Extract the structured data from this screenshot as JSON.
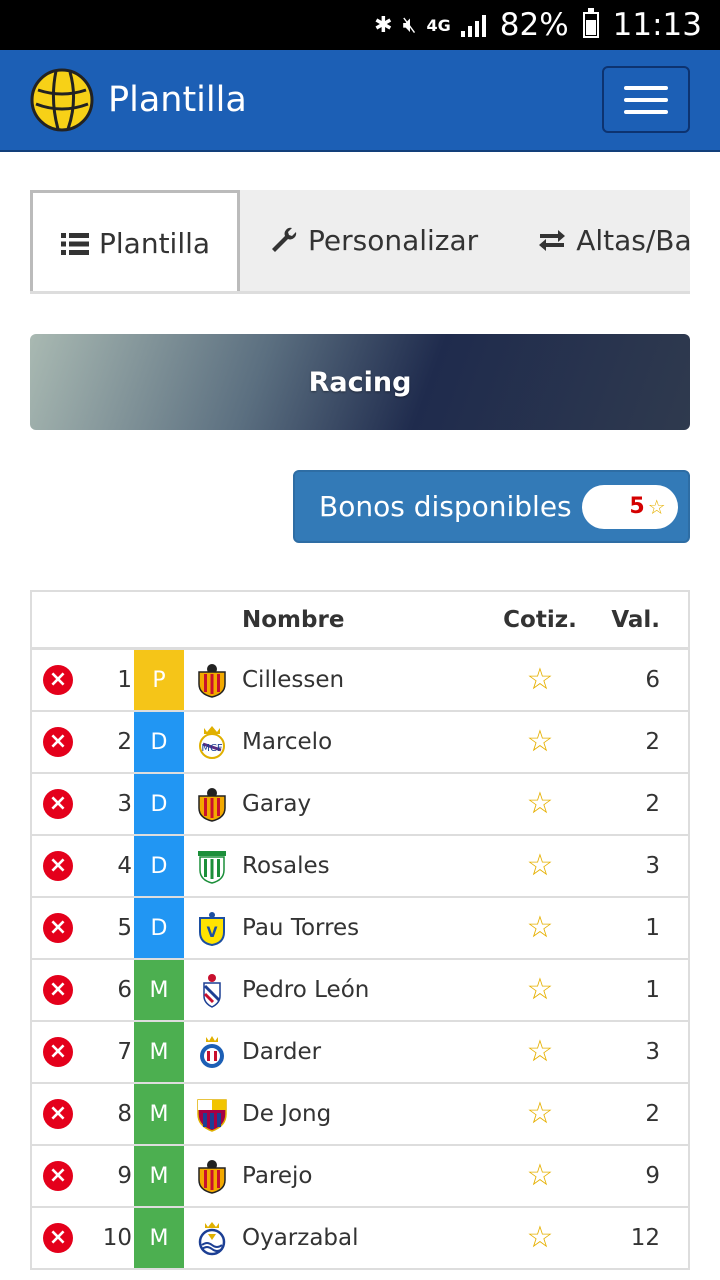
{
  "status_bar": {
    "battery": "82%",
    "time": "11:13",
    "network": "4G"
  },
  "navbar": {
    "title": "Plantilla",
    "logo_icon": "football-icon",
    "menu_icon": "hamburger-icon"
  },
  "tabs": [
    {
      "label": "Plantilla",
      "icon": "list-icon",
      "active": true
    },
    {
      "label": "Personalizar",
      "icon": "wrench-icon",
      "active": false
    },
    {
      "label": "Altas/Bajas",
      "icon": "transfer-icon",
      "active": false
    }
  ],
  "team": {
    "name": "Racing"
  },
  "bonos": {
    "label": "Bonos disponibles",
    "count": "5"
  },
  "table": {
    "headers": {
      "name": "Nombre",
      "cotiz": "Cotiz.",
      "val": "Val."
    },
    "rows": [
      {
        "num": "1",
        "pos": "P",
        "pos_color": "#f5c518",
        "club": "valencia",
        "name": "Cillessen",
        "val": "6"
      },
      {
        "num": "2",
        "pos": "D",
        "pos_color": "#2196f3",
        "club": "real-madrid",
        "name": "Marcelo",
        "val": "2"
      },
      {
        "num": "3",
        "pos": "D",
        "pos_color": "#2196f3",
        "club": "valencia",
        "name": "Garay",
        "val": "2"
      },
      {
        "num": "4",
        "pos": "D",
        "pos_color": "#2196f3",
        "club": "leganes",
        "name": "Rosales",
        "val": "3"
      },
      {
        "num": "5",
        "pos": "D",
        "pos_color": "#2196f3",
        "club": "villarreal",
        "name": "Pau Torres",
        "val": "1"
      },
      {
        "num": "6",
        "pos": "M",
        "pos_color": "#4caf50",
        "club": "eibar",
        "name": "Pedro León",
        "val": "1"
      },
      {
        "num": "7",
        "pos": "M",
        "pos_color": "#4caf50",
        "club": "espanyol",
        "name": "Darder",
        "val": "3"
      },
      {
        "num": "8",
        "pos": "M",
        "pos_color": "#4caf50",
        "club": "barcelona",
        "name": "De Jong",
        "val": "2"
      },
      {
        "num": "9",
        "pos": "M",
        "pos_color": "#4caf50",
        "club": "valencia",
        "name": "Parejo",
        "val": "9"
      },
      {
        "num": "10",
        "pos": "M",
        "pos_color": "#4caf50",
        "club": "real-sociedad",
        "name": "Oyarzabal",
        "val": "12"
      }
    ]
  }
}
